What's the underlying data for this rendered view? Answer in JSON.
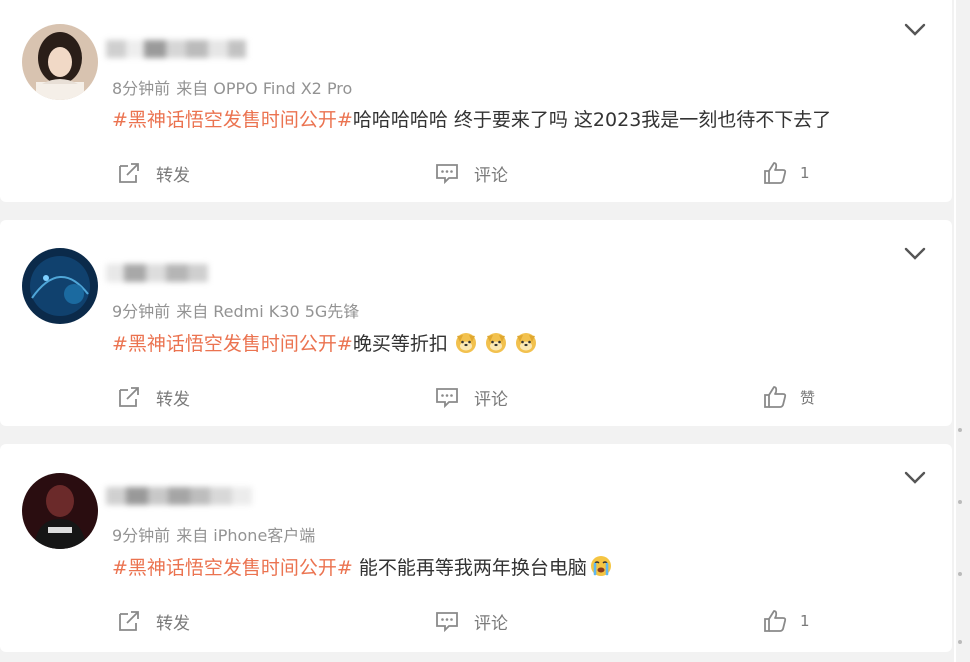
{
  "posts": [
    {
      "meta_time": "8分钟前",
      "meta_source": "来自 OPPO Find X2 Pro",
      "topic": "#黑神话悟空发售时间公开#",
      "body": "哈哈哈哈哈 终于要来了吗 这2023我是一刻也待不下去了",
      "emojis": [],
      "repost_label": "转发",
      "comment_label": "评论",
      "like_label": "1"
    },
    {
      "meta_time": "9分钟前",
      "meta_source": "来自 Redmi K30 5G先锋",
      "topic": "#黑神话悟空发售时间公开#",
      "body": "晚买等折扣",
      "emojis": [
        "doge-emoji",
        "doge-emoji",
        "doge-emoji"
      ],
      "repost_label": "转发",
      "comment_label": "评论",
      "like_label": "赞"
    },
    {
      "meta_time": "9分钟前",
      "meta_source": "来自 iPhone客户端",
      "topic": "#黑神话悟空发售时间公开#",
      "body": " 能不能再等我两年换台电脑",
      "emojis": [
        "crying-emoji"
      ],
      "repost_label": "转发",
      "comment_label": "评论",
      "like_label": "1"
    }
  ],
  "colors": {
    "topic": "#eb7350",
    "muted": "#939393",
    "action": "#7a7a7a",
    "background": "#f2f2f2"
  }
}
